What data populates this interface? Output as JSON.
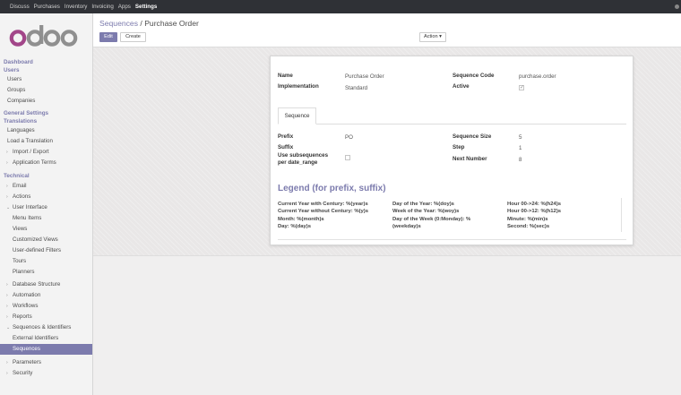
{
  "topbar": {
    "menus": [
      "Discuss",
      "Purchases",
      "Inventory",
      "Invoicing",
      "Apps",
      "Settings"
    ],
    "active": "Settings"
  },
  "logo": {
    "text": "odoo"
  },
  "sidebar": {
    "dashboard": "Dashboard",
    "users_title": "Users",
    "users_items": [
      "Users",
      "Groups",
      "Companies"
    ],
    "general_title": "General Settings",
    "translations_title": "Translations",
    "translations_items": [
      "Languages",
      "Load a Translation",
      "Import / Export",
      "Application Terms"
    ],
    "technical_title": "Technical",
    "technical_items": [
      "Email",
      "Actions",
      "User Interface"
    ],
    "ui_subitems": [
      "Menu Items",
      "Views",
      "Customized Views",
      "User-defined Filters",
      "Tours",
      "Planners"
    ],
    "technical_items2": [
      "Database Structure",
      "Automation",
      "Workflows",
      "Reports",
      "Sequences & Identifiers"
    ],
    "seq_subitems": [
      "External Identifiers",
      "Sequences"
    ],
    "bottom_items": [
      "Parameters",
      "Security"
    ]
  },
  "breadcrumb": {
    "parent": "Sequences",
    "separator": "/",
    "current": "Purchase Order"
  },
  "buttons": {
    "edit": "Edit",
    "create": "Create",
    "action": "Action ▾"
  },
  "form": {
    "name_label": "Name",
    "name_value": "Purchase Order",
    "implementation_label": "Implementation",
    "implementation_value": "Standard",
    "code_label": "Sequence Code",
    "code_value": "purchase.order",
    "active_label": "Active",
    "active_checked": true,
    "tab_label": "Sequence",
    "prefix_label": "Prefix",
    "prefix_value": "PO",
    "suffix_label": "Suffix",
    "suffix_value": "",
    "subseq_label_1": "Use subsequences",
    "subseq_label_2": "per date_range",
    "size_label": "Sequence Size",
    "size_value": "5",
    "step_label": "Step",
    "step_value": "1",
    "next_label": "Next Number",
    "next_value": "8"
  },
  "legend": {
    "title": "Legend (for prefix, suffix)",
    "col1": [
      "Current Year with Century: %(year)s",
      "Current Year without Century: %(y)s",
      "Month: %(month)s",
      "Day: %(day)s"
    ],
    "col2": [
      "Day of the Year: %(doy)s",
      "Week of the Year: %(woy)s",
      "Day of the Week (0:Monday): %",
      "(weekday)s"
    ],
    "col3": [
      "Hour 00->24: %(h24)s",
      "Hour 00->12: %(h12)s",
      "Minute: %(min)s",
      "Second: %(sec)s"
    ]
  }
}
